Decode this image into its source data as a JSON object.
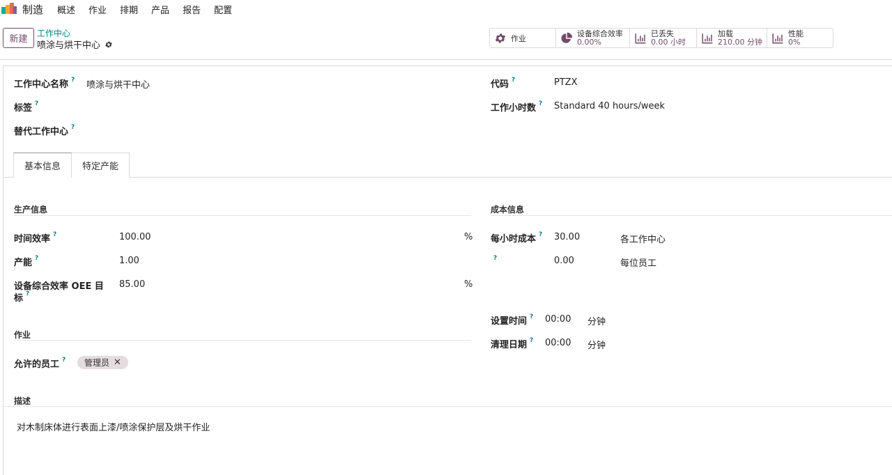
{
  "nav": {
    "app_name": "制造",
    "menu": [
      "概述",
      "作业",
      "排期",
      "产品",
      "报告",
      "配置"
    ]
  },
  "control": {
    "new_label": "新建",
    "breadcrumb_parent": "工作中心",
    "breadcrumb_current": "喷涂与烘干中心"
  },
  "stats": {
    "operations": "作业",
    "oee_label": "设备综合效率",
    "oee_value": "0.00%",
    "lost_label": "已丢失",
    "lost_value": "0.00 小时",
    "load_label": "加载",
    "load_value": "210.00 分钟",
    "perf_label": "性能",
    "perf_value": "0%"
  },
  "form": {
    "name_label": "工作中心名称",
    "name_value": "喷涂与烘干中心",
    "tags_label": "标签",
    "alt_label": "替代工作中心",
    "code_label": "代码",
    "code_value": "PTZX",
    "hours_label": "工作小时数",
    "hours_value": "Standard 40 hours/week",
    "q": "?"
  },
  "tabs": [
    "基本信息",
    "特定产能"
  ],
  "production": {
    "title": "生产信息",
    "time_eff_label": "时间效率",
    "time_eff_value": "100.00",
    "time_eff_unit": "%",
    "capacity_label": "产能",
    "capacity_value": "1.00",
    "oee_target_label_1": "设备综合效率 OEE 目",
    "oee_target_label_2": "标",
    "oee_target_value": "85.00",
    "oee_target_unit": "%"
  },
  "cost": {
    "title": "成本信息",
    "hourly_label": "每小时成本",
    "hourly_value": "30.00",
    "hourly_unit": "各工作中心",
    "employee_value": "0.00",
    "employee_unit": "每位员工",
    "setup_label": "设置时间",
    "setup_value": "00:00",
    "setup_unit": "分钟",
    "cleanup_label": "清理日期",
    "cleanup_value": "00:00",
    "cleanup_unit": "分钟"
  },
  "operations": {
    "title": "作业",
    "allowed_label": "允许的员工",
    "tag": "管理员"
  },
  "description": {
    "title": "描述",
    "text": "对木制床体进行表面上漆/喷涂保护层及烘干作业"
  }
}
